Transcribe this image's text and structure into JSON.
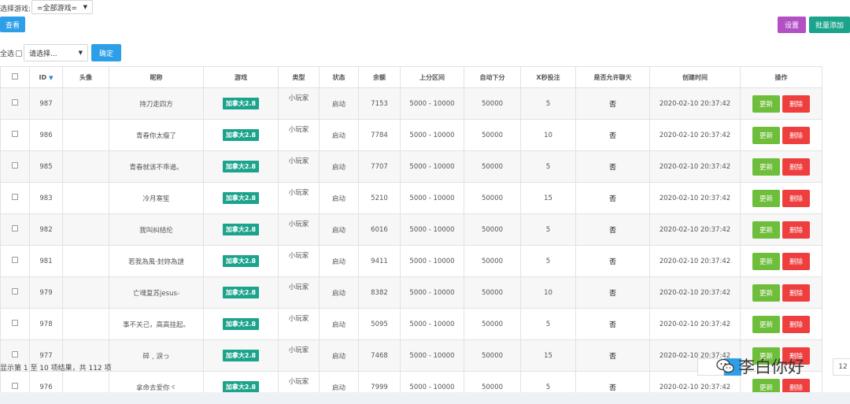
{
  "filter": {
    "label": "选择游戏:",
    "game_select_value": "=全部游戏=",
    "view_button": "查看"
  },
  "toolbar": {
    "settings_label": "设置",
    "batch_add_label": "批量添加"
  },
  "bulk": {
    "select_all_label": "全选",
    "action_select_value": "请选择...",
    "confirm_label": "确定"
  },
  "table": {
    "headers": [
      "ID",
      "头像",
      "昵称",
      "游戏",
      "类型",
      "状态",
      "余额",
      "上分区间",
      "自动下分",
      "X秒投注",
      "是否允许聊天",
      "创建时间",
      "操作"
    ],
    "rows": [
      {
        "id": "987",
        "nickname": "持刀走四方",
        "game": "加拿大2.8",
        "type": "小玩家",
        "status": "启动",
        "balance": "7153",
        "range": "5000 - 10000",
        "auto_down": "50000",
        "x_sec": "5",
        "allow_chat": "否",
        "created": "2020-02-10 20:37:42",
        "update": "更新",
        "delete": "删除"
      },
      {
        "id": "986",
        "nickname": "青春你太瘦了",
        "game": "加拿大2.8",
        "type": "小玩家",
        "status": "启动",
        "balance": "7784",
        "range": "5000 - 10000",
        "auto_down": "50000",
        "x_sec": "10",
        "allow_chat": "否",
        "created": "2020-02-10 20:37:42",
        "update": "更新",
        "delete": "删除"
      },
      {
        "id": "985",
        "nickname": "青春就该不乖道。",
        "game": "加拿大2.8",
        "type": "小玩家",
        "status": "启动",
        "balance": "7707",
        "range": "5000 - 10000",
        "auto_down": "50000",
        "x_sec": "5",
        "allow_chat": "否",
        "created": "2020-02-10 20:37:42",
        "update": "更新",
        "delete": "删除"
      },
      {
        "id": "983",
        "nickname": "冷月寒笙",
        "game": "加拿大2.8",
        "type": "小玩家",
        "status": "启动",
        "balance": "5210",
        "range": "5000 - 10000",
        "auto_down": "50000",
        "x_sec": "15",
        "allow_chat": "否",
        "created": "2020-02-10 20:37:42",
        "update": "更新",
        "delete": "删除"
      },
      {
        "id": "982",
        "nickname": "我叫纠结伦",
        "game": "加拿大2.8",
        "type": "小玩家",
        "status": "启动",
        "balance": "6016",
        "range": "5000 - 10000",
        "auto_down": "50000",
        "x_sec": "5",
        "allow_chat": "否",
        "created": "2020-02-10 20:37:42",
        "update": "更新",
        "delete": "删除"
      },
      {
        "id": "981",
        "nickname": "若我為風·封妳為謎",
        "game": "加拿大2.8",
        "type": "小玩家",
        "status": "启动",
        "balance": "9411",
        "range": "5000 - 10000",
        "auto_down": "50000",
        "x_sec": "5",
        "allow_chat": "否",
        "created": "2020-02-10 20:37:42",
        "update": "更新",
        "delete": "删除"
      },
      {
        "id": "979",
        "nickname": "亡魂复苏jesus-",
        "game": "加拿大2.8",
        "type": "小玩家",
        "status": "启动",
        "balance": "8382",
        "range": "5000 - 10000",
        "auto_down": "50000",
        "x_sec": "10",
        "allow_chat": "否",
        "created": "2020-02-10 20:37:42",
        "update": "更新",
        "delete": "删除"
      },
      {
        "id": "978",
        "nickname": "事不关己，高高挂起。",
        "game": "加拿大2.8",
        "type": "小玩家",
        "status": "启动",
        "balance": "5095",
        "range": "5000 - 10000",
        "auto_down": "50000",
        "x_sec": "5",
        "allow_chat": "否",
        "created": "2020-02-10 20:37:42",
        "update": "更新",
        "delete": "删除"
      },
      {
        "id": "977",
        "nickname": "碎﹐淚っ",
        "game": "加拿大2.8",
        "type": "小玩家",
        "status": "启动",
        "balance": "7468",
        "range": "5000 - 10000",
        "auto_down": "50000",
        "x_sec": "15",
        "allow_chat": "否",
        "created": "2020-02-10 20:37:42",
        "update": "更新",
        "delete": "删除"
      },
      {
        "id": "976",
        "nickname": "拿命去爱你ヾ",
        "game": "加拿大2.8",
        "type": "小玩家",
        "status": "启动",
        "balance": "7999",
        "range": "5000 - 10000",
        "auto_down": "50000",
        "x_sec": "5",
        "allow_chat": "否",
        "created": "2020-02-10 20:37:42",
        "update": "更新",
        "delete": "删除"
      }
    ]
  },
  "footer": {
    "summary": "显示第 1 至 10 项结果，共 112 项",
    "pager_next": "12"
  },
  "watermark": {
    "text": "李白你好",
    "icon": "wechat-icon"
  },
  "colors": {
    "primary": "#2d9ee8",
    "settings": "#b250c4",
    "batch_add": "#1ca38c",
    "update": "#6fbe3b",
    "delete": "#ef3e3e",
    "status_active": "#1a9a2c",
    "tag": "#1ca38c"
  }
}
